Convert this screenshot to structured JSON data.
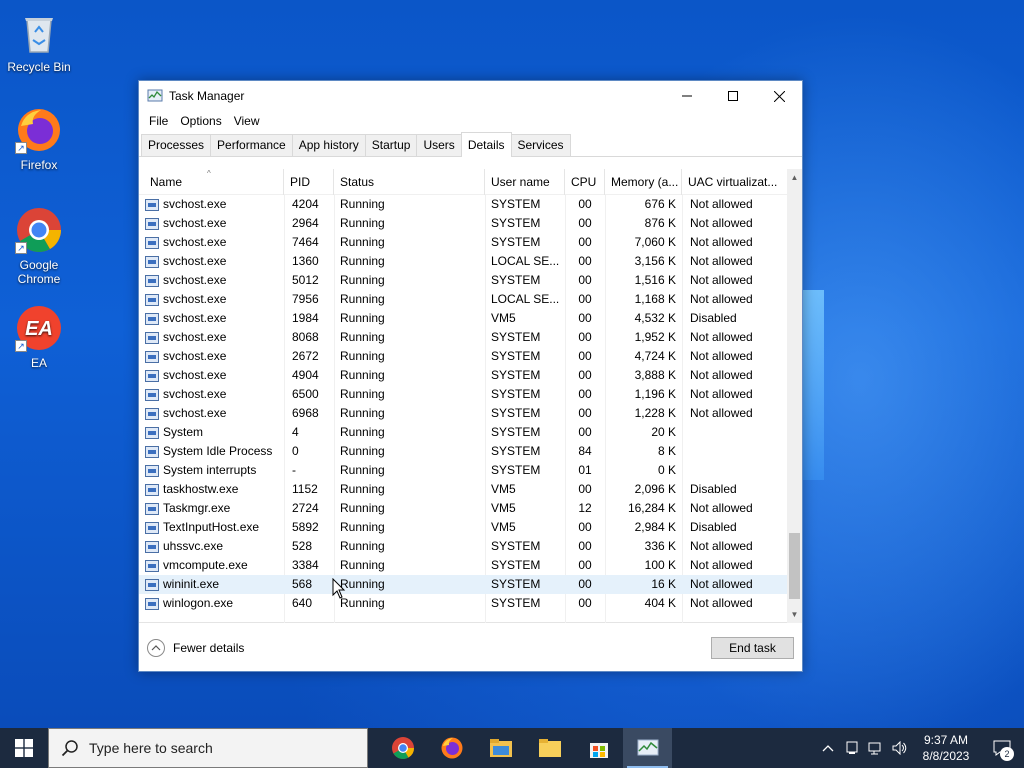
{
  "desktop": {
    "icons": [
      {
        "label": "Recycle Bin",
        "icon": "recycle-bin-icon"
      },
      {
        "label": "Firefox",
        "icon": "firefox-icon"
      },
      {
        "label": "Google Chrome",
        "icon": "chrome-icon"
      },
      {
        "label": "EA",
        "icon": "ea-icon"
      }
    ]
  },
  "window": {
    "title": "Task Manager",
    "menu": [
      "File",
      "Options",
      "View"
    ],
    "tabs": [
      "Processes",
      "Performance",
      "App history",
      "Startup",
      "Users",
      "Details",
      "Services"
    ],
    "active_tab": "Details",
    "columns": [
      "Name",
      "PID",
      "Status",
      "User name",
      "CPU",
      "Memory (a...",
      "UAC virtualizat..."
    ],
    "rows": [
      {
        "name": "svchost.exe",
        "pid": "4204",
        "status": "Running",
        "user": "SYSTEM",
        "cpu": "00",
        "mem": "676 K",
        "uac": "Not allowed"
      },
      {
        "name": "svchost.exe",
        "pid": "2964",
        "status": "Running",
        "user": "SYSTEM",
        "cpu": "00",
        "mem": "876 K",
        "uac": "Not allowed"
      },
      {
        "name": "svchost.exe",
        "pid": "7464",
        "status": "Running",
        "user": "SYSTEM",
        "cpu": "00",
        "mem": "7,060 K",
        "uac": "Not allowed"
      },
      {
        "name": "svchost.exe",
        "pid": "1360",
        "status": "Running",
        "user": "LOCAL SE...",
        "cpu": "00",
        "mem": "3,156 K",
        "uac": "Not allowed"
      },
      {
        "name": "svchost.exe",
        "pid": "5012",
        "status": "Running",
        "user": "SYSTEM",
        "cpu": "00",
        "mem": "1,516 K",
        "uac": "Not allowed"
      },
      {
        "name": "svchost.exe",
        "pid": "7956",
        "status": "Running",
        "user": "LOCAL SE...",
        "cpu": "00",
        "mem": "1,168 K",
        "uac": "Not allowed"
      },
      {
        "name": "svchost.exe",
        "pid": "1984",
        "status": "Running",
        "user": "VM5",
        "cpu": "00",
        "mem": "4,532 K",
        "uac": "Disabled"
      },
      {
        "name": "svchost.exe",
        "pid": "8068",
        "status": "Running",
        "user": "SYSTEM",
        "cpu": "00",
        "mem": "1,952 K",
        "uac": "Not allowed"
      },
      {
        "name": "svchost.exe",
        "pid": "2672",
        "status": "Running",
        "user": "SYSTEM",
        "cpu": "00",
        "mem": "4,724 K",
        "uac": "Not allowed"
      },
      {
        "name": "svchost.exe",
        "pid": "4904",
        "status": "Running",
        "user": "SYSTEM",
        "cpu": "00",
        "mem": "3,888 K",
        "uac": "Not allowed"
      },
      {
        "name": "svchost.exe",
        "pid": "6500",
        "status": "Running",
        "user": "SYSTEM",
        "cpu": "00",
        "mem": "1,196 K",
        "uac": "Not allowed"
      },
      {
        "name": "svchost.exe",
        "pid": "6968",
        "status": "Running",
        "user": "SYSTEM",
        "cpu": "00",
        "mem": "1,228 K",
        "uac": "Not allowed"
      },
      {
        "name": "System",
        "pid": "4",
        "status": "Running",
        "user": "SYSTEM",
        "cpu": "00",
        "mem": "20 K",
        "uac": ""
      },
      {
        "name": "System Idle Process",
        "pid": "0",
        "status": "Running",
        "user": "SYSTEM",
        "cpu": "84",
        "mem": "8 K",
        "uac": ""
      },
      {
        "name": "System interrupts",
        "pid": "-",
        "status": "Running",
        "user": "SYSTEM",
        "cpu": "01",
        "mem": "0 K",
        "uac": ""
      },
      {
        "name": "taskhostw.exe",
        "pid": "1152",
        "status": "Running",
        "user": "VM5",
        "cpu": "00",
        "mem": "2,096 K",
        "uac": "Disabled"
      },
      {
        "name": "Taskmgr.exe",
        "pid": "2724",
        "status": "Running",
        "user": "VM5",
        "cpu": "12",
        "mem": "16,284 K",
        "uac": "Not allowed"
      },
      {
        "name": "TextInputHost.exe",
        "pid": "5892",
        "status": "Running",
        "user": "VM5",
        "cpu": "00",
        "mem": "2,984 K",
        "uac": "Disabled"
      },
      {
        "name": "uhssvc.exe",
        "pid": "528",
        "status": "Running",
        "user": "SYSTEM",
        "cpu": "00",
        "mem": "336 K",
        "uac": "Not allowed"
      },
      {
        "name": "vmcompute.exe",
        "pid": "3384",
        "status": "Running",
        "user": "SYSTEM",
        "cpu": "00",
        "mem": "100 K",
        "uac": "Not allowed"
      },
      {
        "name": "wininit.exe",
        "pid": "568",
        "status": "Running",
        "user": "SYSTEM",
        "cpu": "00",
        "mem": "16 K",
        "uac": "Not allowed"
      },
      {
        "name": "winlogon.exe",
        "pid": "640",
        "status": "Running",
        "user": "SYSTEM",
        "cpu": "00",
        "mem": "404 K",
        "uac": "Not allowed"
      }
    ],
    "hover_row": 20,
    "fewer_details": "Fewer details",
    "end_task": "End task"
  },
  "taskbar": {
    "search_placeholder": "Type here to search",
    "apps": [
      "chrome-icon",
      "firefox-icon",
      "file-explorer-icon",
      "folder-icon",
      "store-icon",
      "task-manager-icon"
    ],
    "time": "9:37 AM",
    "date": "8/8/2023",
    "notification_count": "2"
  },
  "colors": {
    "taskbar": "#1c2a3f",
    "desktop": "#0b56c8",
    "row_hover": "#e5f1fb"
  }
}
